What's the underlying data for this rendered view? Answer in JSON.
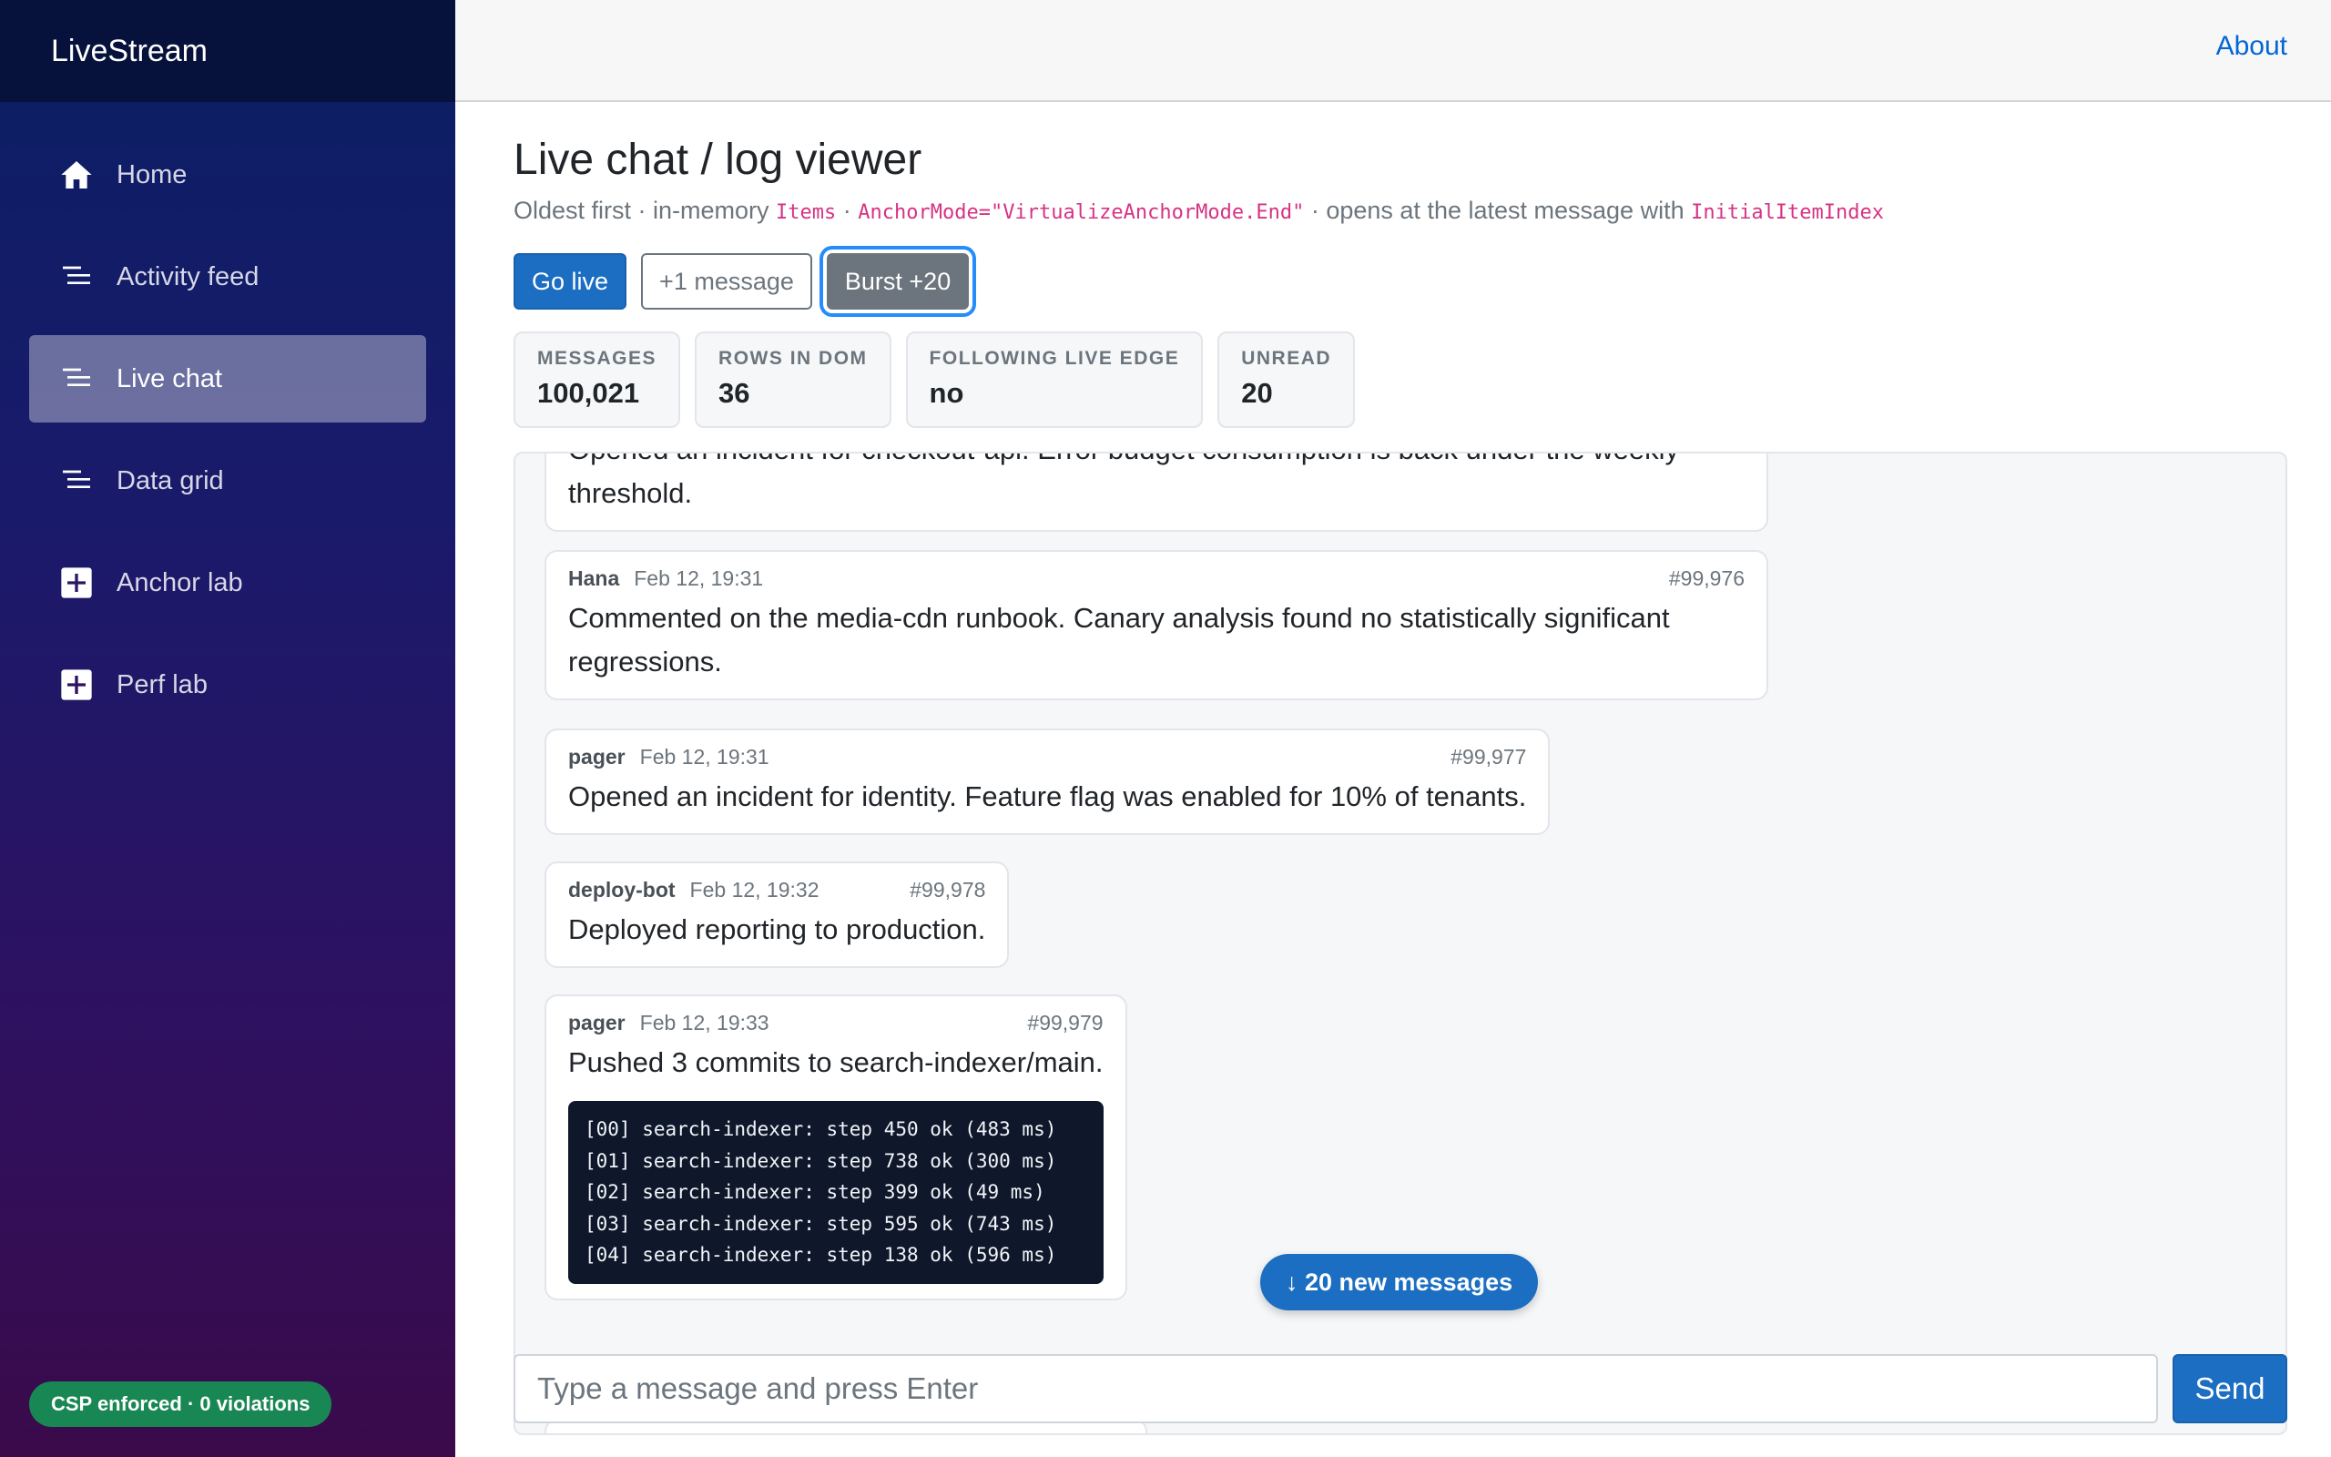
{
  "app": {
    "brand": "LiveStream"
  },
  "sidebar": {
    "items": [
      {
        "label": "Home",
        "icon": "home-icon"
      },
      {
        "label": "Activity feed",
        "icon": "list-icon"
      },
      {
        "label": "Live chat",
        "icon": "list-icon",
        "active": true
      },
      {
        "label": "Data grid",
        "icon": "list-icon"
      },
      {
        "label": "Anchor lab",
        "icon": "plus-icon"
      },
      {
        "label": "Perf lab",
        "icon": "plus-icon"
      }
    ],
    "csp_badge": "CSP enforced · 0 violations"
  },
  "topbar": {
    "about": "About"
  },
  "page": {
    "title": "Live chat / log viewer",
    "subtitle": {
      "t1": "Oldest first · in-memory ",
      "c1": "Items",
      "t2": " · ",
      "c2": "AnchorMode=\"VirtualizeAnchorMode.End\"",
      "t3": " · opens at the latest message with ",
      "c3": "InitialItemIndex"
    }
  },
  "buttons": {
    "go_live": "Go live",
    "plus_one": "+1 message",
    "burst": "Burst +20"
  },
  "stats": [
    {
      "label": "MESSAGES",
      "value": "100,021"
    },
    {
      "label": "ROWS IN DOM",
      "value": "36"
    },
    {
      "label": "FOLLOWING LIVE EDGE",
      "value": "no"
    },
    {
      "label": "UNREAD",
      "value": "20"
    }
  ],
  "messages": [
    {
      "author": "",
      "time": "",
      "id": "",
      "body": "Opened an incident for checkout-api. Error budget consumption is back under the weekly threshold."
    },
    {
      "author": "Hana",
      "time": "Feb 12, 19:31",
      "id": "#99,976",
      "body": "Commented on the media-cdn runbook. Canary analysis found no statistically significant regressions."
    },
    {
      "author": "pager",
      "time": "Feb 12, 19:31",
      "id": "#99,977",
      "body": "Opened an incident for identity. Feature flag was enabled for 10% of tenants."
    },
    {
      "author": "deploy-bot",
      "time": "Feb 12, 19:32",
      "id": "#99,978",
      "body": "Deployed reporting to production."
    },
    {
      "author": "pager",
      "time": "Feb 12, 19:33",
      "id": "#99,979",
      "body": "Pushed 3 commits to search-indexer/main.",
      "code": [
        "[00] search-indexer: step 450 ok (483 ms)",
        "[01] search-indexer: step 738 ok (300 ms)",
        "[02] search-indexer: step 399 ok (49 ms)",
        "[03] search-indexer: step 595 ok (743 ms)",
        "[04] search-indexer: step 138 ok (596 ms)"
      ]
    }
  ],
  "new_messages_pill": "↓ 20 new messages",
  "composer": {
    "placeholder": "Type a message and press Enter",
    "send": "Send"
  }
}
